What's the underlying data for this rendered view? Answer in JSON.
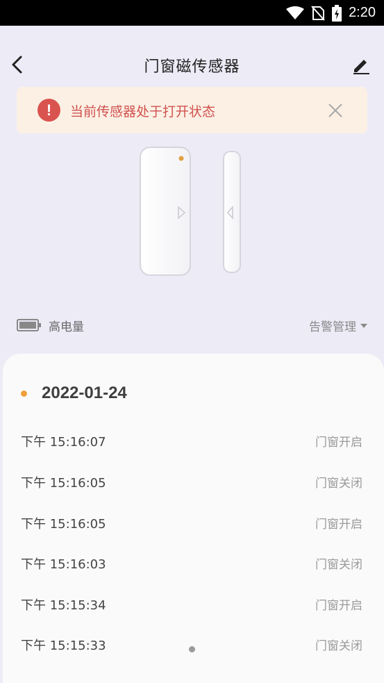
{
  "status_bar": {
    "time": "2:20"
  },
  "header": {
    "title": "门窗磁传感器"
  },
  "alert": {
    "text": "当前传感器处于打开状态",
    "color": "#d0514f",
    "background": "#fcf0e4"
  },
  "battery": {
    "label": "高电量"
  },
  "alarm_management": {
    "label": "告警管理"
  },
  "records": {
    "date": "2022-01-24",
    "items": [
      {
        "time": "下午  15:16:07",
        "event": "门窗开启"
      },
      {
        "time": "下午  15:16:05",
        "event": "门窗关闭"
      },
      {
        "time": "下午  15:16:05",
        "event": "门窗开启"
      },
      {
        "time": "下午  15:16:03",
        "event": "门窗关闭"
      },
      {
        "time": "下午  15:15:34",
        "event": "门窗开启"
      },
      {
        "time": "下午  15:15:33",
        "event": "门窗关闭"
      }
    ]
  },
  "icons": {
    "back": "back-arrow-icon",
    "edit": "pencil-icon",
    "alert": "exclamation-circle-icon",
    "close": "close-icon",
    "battery": "battery-icon",
    "dropdown": "caret-down-icon"
  },
  "colors": {
    "accent": "#f0a03a",
    "background": "#ecebf6",
    "alert": "#d9534f"
  }
}
